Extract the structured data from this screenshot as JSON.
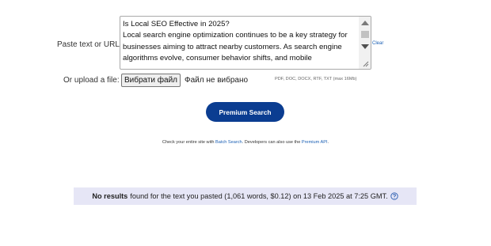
{
  "form": {
    "paste_label": "Paste text or URL:",
    "textarea_value": "Is Local SEO Effective in 2025?\nLocal search engine optimization continues to be a key strategy for businesses aiming to attract nearby customers. As search engine algorithms evolve, consumer behavior shifts, and mobile",
    "clear_label": "Clear",
    "upload_label": "Or upload a file:",
    "file_button_label": "Вибрати файл",
    "file_status": "Файл не вибрано",
    "file_hint": "PDF, DOC, DOCX, RTF, TXT (max 16Mb)",
    "submit_label": "Premium Search"
  },
  "links": {
    "prefix": "Check your entire site with ",
    "batch_search": "Batch Search",
    "middle": ". Developers can also use the ",
    "premium_api": "Premium API",
    "suffix": "."
  },
  "results": {
    "bold": "No results",
    "text": "found for the text you pasted (1,061 words, $0.12) on 13 Feb 2025 at 7:25 GMT.",
    "icon": "help-circle-icon"
  },
  "colors": {
    "button_bg": "#0b3d91",
    "link": "#1a5fb4",
    "results_bg": "#e6e6f6"
  }
}
